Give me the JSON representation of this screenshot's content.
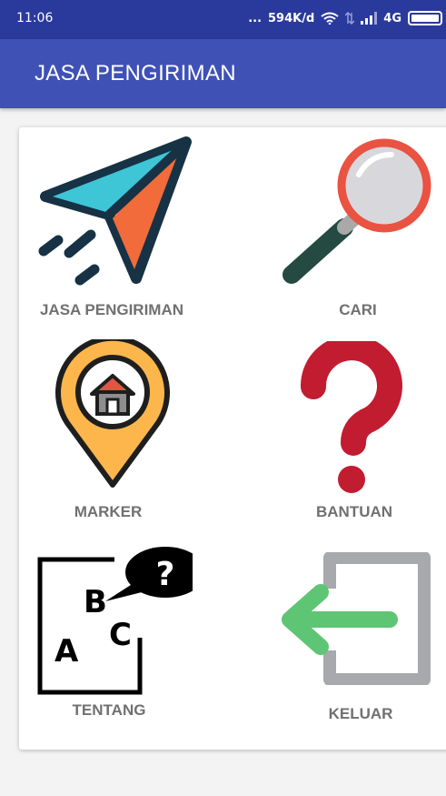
{
  "status_bar": {
    "time": "11:06",
    "dots": "...",
    "network_speed": "594K/d",
    "network_type": "4G",
    "icons": [
      "wifi-icon",
      "data-transfer-icon",
      "signal-icon",
      "battery-icon"
    ]
  },
  "app_bar": {
    "title": "JASA PENGIRIMAN",
    "color": "#3f51b5"
  },
  "menu": {
    "items": [
      {
        "label": "JASA PENGIRIMAN",
        "icon": "paper-plane-icon"
      },
      {
        "label": "CARI",
        "icon": "magnifier-icon"
      },
      {
        "label": "MARKER",
        "icon": "map-marker-icon"
      },
      {
        "label": "BANTUAN",
        "icon": "question-mark-icon"
      },
      {
        "label": "TENTANG",
        "icon": "abc-question-icon"
      },
      {
        "label": "KELUAR",
        "icon": "exit-icon"
      }
    ]
  }
}
